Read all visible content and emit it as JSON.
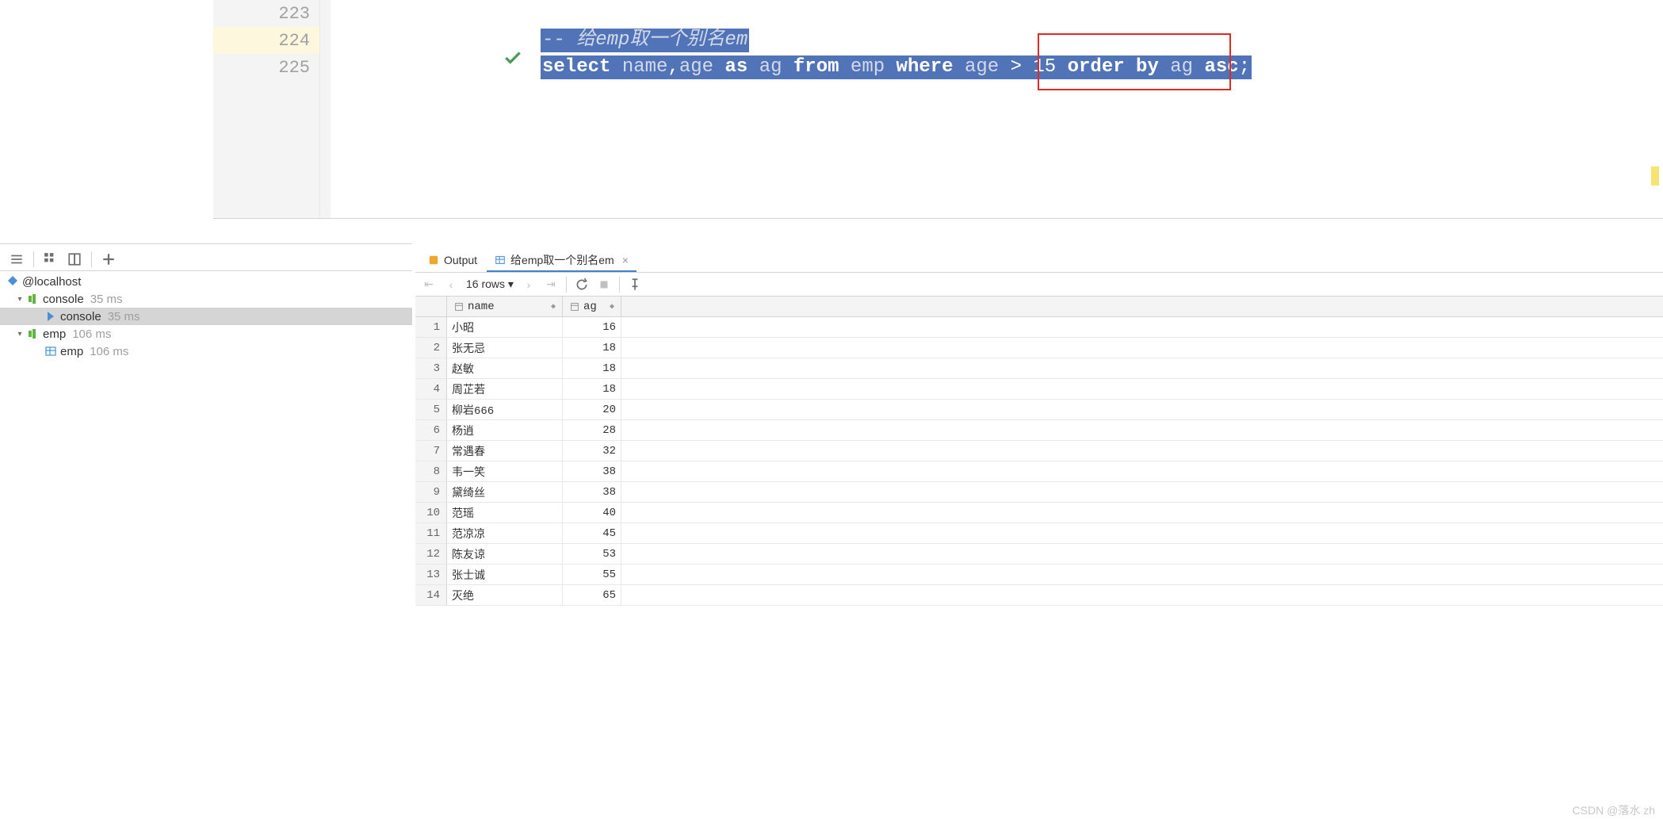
{
  "editor": {
    "lines": [
      {
        "num": "223"
      },
      {
        "num": "224"
      },
      {
        "num": "225"
      }
    ],
    "comment": "-- 给emp取一个别名em",
    "sql": {
      "select": "select",
      "name": "name",
      "comma": ",",
      "age": "age",
      "as": "as",
      "ag": "ag",
      "from": "from",
      "emp": "emp",
      "where": "where",
      "age2": "age",
      "gt": ">",
      "fifteen": "15",
      "order": "order by",
      "ag2": "ag",
      "asc": "asc",
      "semi": ";"
    }
  },
  "services": {
    "host": "@localhost",
    "console_group": "console",
    "console_group_time": "35 ms",
    "console_child": "console",
    "console_child_time": "35 ms",
    "emp_group": "emp",
    "emp_group_time": "106 ms",
    "emp_child": "emp",
    "emp_child_time": "106 ms"
  },
  "tabs": {
    "output": "Output",
    "query": "给emp取一个别名em"
  },
  "result_toolbar": {
    "rows": "16 rows"
  },
  "grid": {
    "headers": {
      "name": "name",
      "ag": "ag"
    },
    "rows": [
      {
        "n": "1",
        "name": "小昭",
        "ag": "16"
      },
      {
        "n": "2",
        "name": "张无忌",
        "ag": "18"
      },
      {
        "n": "3",
        "name": "赵敏",
        "ag": "18"
      },
      {
        "n": "4",
        "name": "周芷若",
        "ag": "18"
      },
      {
        "n": "5",
        "name": "柳岩666",
        "ag": "20"
      },
      {
        "n": "6",
        "name": "杨逍",
        "ag": "28"
      },
      {
        "n": "7",
        "name": "常遇春",
        "ag": "32"
      },
      {
        "n": "8",
        "name": "韦一笑",
        "ag": "38"
      },
      {
        "n": "9",
        "name": "黛绮丝",
        "ag": "38"
      },
      {
        "n": "10",
        "name": "范瑶",
        "ag": "40"
      },
      {
        "n": "11",
        "name": "范凉凉",
        "ag": "45"
      },
      {
        "n": "12",
        "name": "陈友谅",
        "ag": "53"
      },
      {
        "n": "13",
        "name": "张士诚",
        "ag": "55"
      },
      {
        "n": "14",
        "name": "灭绝",
        "ag": "65"
      }
    ]
  },
  "watermark": "CSDN @落水 zh"
}
